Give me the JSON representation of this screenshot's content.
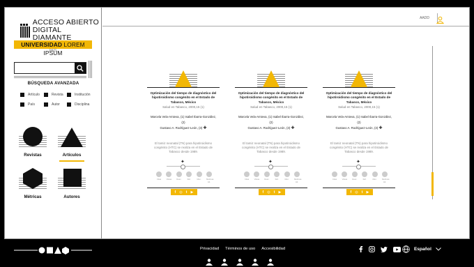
{
  "brand": {
    "logo_line1": "ACCESO ABIERTO",
    "logo_line2": "DIGITAL DIAMANTE",
    "university_bold": "UNIVERSIDAD",
    "university_thin": "LOREM IPSUM",
    "country": "PAÍS"
  },
  "search": {
    "placeholder": "",
    "advanced_label": "BÚSQUEDA AVANZADA"
  },
  "filters": [
    "Artículo",
    "Revista",
    "Institución",
    "País",
    "Autor",
    "Disciplina"
  ],
  "nav": {
    "revistas": "Revistas",
    "articulos": "Artículos",
    "metricas": "Métricas",
    "autores": "Autores"
  },
  "header": {
    "link": "AADD"
  },
  "cards": [
    {
      "title": "Optimización del tiempo de diagnóstico del hipotiroidismo congénito en el Estado de Tabasco, México",
      "journal": "Salud en Tabasco, 2000,15 (1)",
      "authors_line1": "Marcela Vela-Amieva, (1) Isabel Ibarra-González, (2)",
      "authors_line2": "Gustavo A. Rodríguez-León, (3)",
      "abstract": "El tamiz neonatal (TN) para hipotiroidismo congénito (HTC) se realiza en el Estado de Tabasco desde 1989.",
      "metrics": [
        "Citas",
        "Vistas",
        "Desc.",
        "Ref.",
        "Men.",
        "Métricas Alt."
      ]
    },
    {
      "title": "Optimización del tiempo de diagnóstico del hipotiroidismo congénito en el Estado de Tabasco, México",
      "journal": "Salud en Tabasco, 2000,15 (1)",
      "authors_line1": "Marcela Vela-Amieva, (1) Isabel Ibarra-González, (2)",
      "authors_line2": "Gustavo A. Rodríguez-León, (3)",
      "abstract": "El tamiz neonatal (TN) para hipotiroidismo congénito (HTC) se realiza en el Estado de Tabasco desde 1989.",
      "metrics": [
        "Citas",
        "Vistas",
        "Desc.",
        "Ref.",
        "Men.",
        "Métricas Alt."
      ]
    },
    {
      "title": "Optimización del tiempo de diagnóstico del hipotiroidismo congénito en el Estado de Tabasco, México",
      "journal": "Salud en Tabasco, 2000,15 (1)",
      "authors_line1": "Marcela Vela-Amieva, (1) Isabel Ibarra-González, (2)",
      "authors_line2": "Gustavo A. Rodríguez-León, (3)",
      "abstract": "El tamiz neonatal (TN) para hipotiroidismo congénito (HTC) se realiza en el Estado de Tabasco desde 1989.",
      "metrics": [
        "Citas",
        "Vistas",
        "Desc.",
        "Ref.",
        "Men.",
        "Métricas Alt."
      ]
    }
  ],
  "footer": {
    "links": [
      "Privacidad",
      "Términos de uso",
      "Accesibilidad"
    ],
    "language": "Español",
    "social_icons": [
      "facebook-icon",
      "instagram-icon",
      "twitter-icon",
      "youtube-icon"
    ]
  },
  "colors": {
    "accent": "#f2b705",
    "dark": "#111111",
    "background": "#000000"
  }
}
